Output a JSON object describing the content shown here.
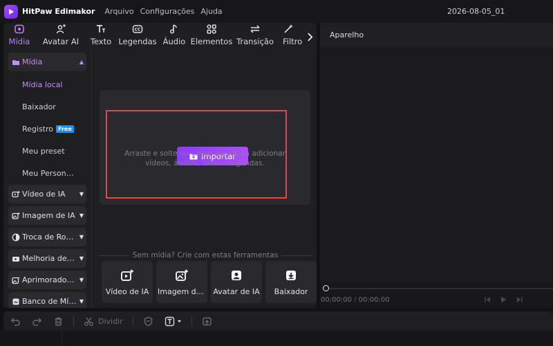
{
  "app": {
    "name": "HitPaw Edimakor",
    "project_name": "2026-08-05_01"
  },
  "menu": {
    "items": [
      "Arquivo",
      "Configurações",
      "Ajuda"
    ]
  },
  "tabs": {
    "items": [
      {
        "label": "Mídia",
        "icon": "media-icon",
        "active": true
      },
      {
        "label": "Avatar AI",
        "icon": "avatar-ai-icon",
        "active": false
      },
      {
        "label": "Texto",
        "icon": "text-icon",
        "active": false
      },
      {
        "label": "Legendas",
        "icon": "subtitles-icon",
        "active": false
      },
      {
        "label": "Áudio",
        "icon": "audio-icon",
        "active": false
      },
      {
        "label": "Elementos",
        "icon": "elements-icon",
        "active": false
      },
      {
        "label": "Transição",
        "icon": "transition-icon",
        "active": false
      },
      {
        "label": "Filtro",
        "icon": "filter-icon",
        "active": false
      }
    ]
  },
  "sidebar": {
    "media_label": "Mídia",
    "sub_items": [
      "Mídia local",
      "Baixador",
      "Registro",
      "Meu preset",
      "Meu Personalizado"
    ],
    "free_badge": "Free",
    "categories": [
      "Vídeo de IA",
      "Imagem de IA",
      "Troca de Rosto",
      "Melhoria de Vídeo",
      "Aprimorador de Foto",
      "Banco de Mídia"
    ]
  },
  "import": {
    "button_label": "Importar",
    "hint_line1": "Arraste e solte ou clique aqui para adicionar",
    "hint_line2": "vídeos, áudios, fotos e legendas."
  },
  "tools": {
    "heading": "Sem mídia? Crie com estas ferramentas",
    "cards": [
      {
        "label": "Vídeo de IA",
        "icon": "ai-video-icon"
      },
      {
        "label": "Imagem de IA",
        "icon": "ai-image-icon"
      },
      {
        "label": "Avatar de IA",
        "icon": "ai-avatar-icon"
      },
      {
        "label": "Baixador",
        "icon": "download-icon"
      }
    ]
  },
  "player": {
    "title": "Aparelho",
    "current_time": "00:00:00",
    "total_time": "00:00:00",
    "time_separator": "/"
  },
  "bottom_toolbar": {
    "split_label": "Dividir"
  },
  "colors": {
    "accent": "#b97cff",
    "import_button": "#9a40ff",
    "highlight_border": "#e04a48",
    "free_badge": "#1890ff"
  }
}
